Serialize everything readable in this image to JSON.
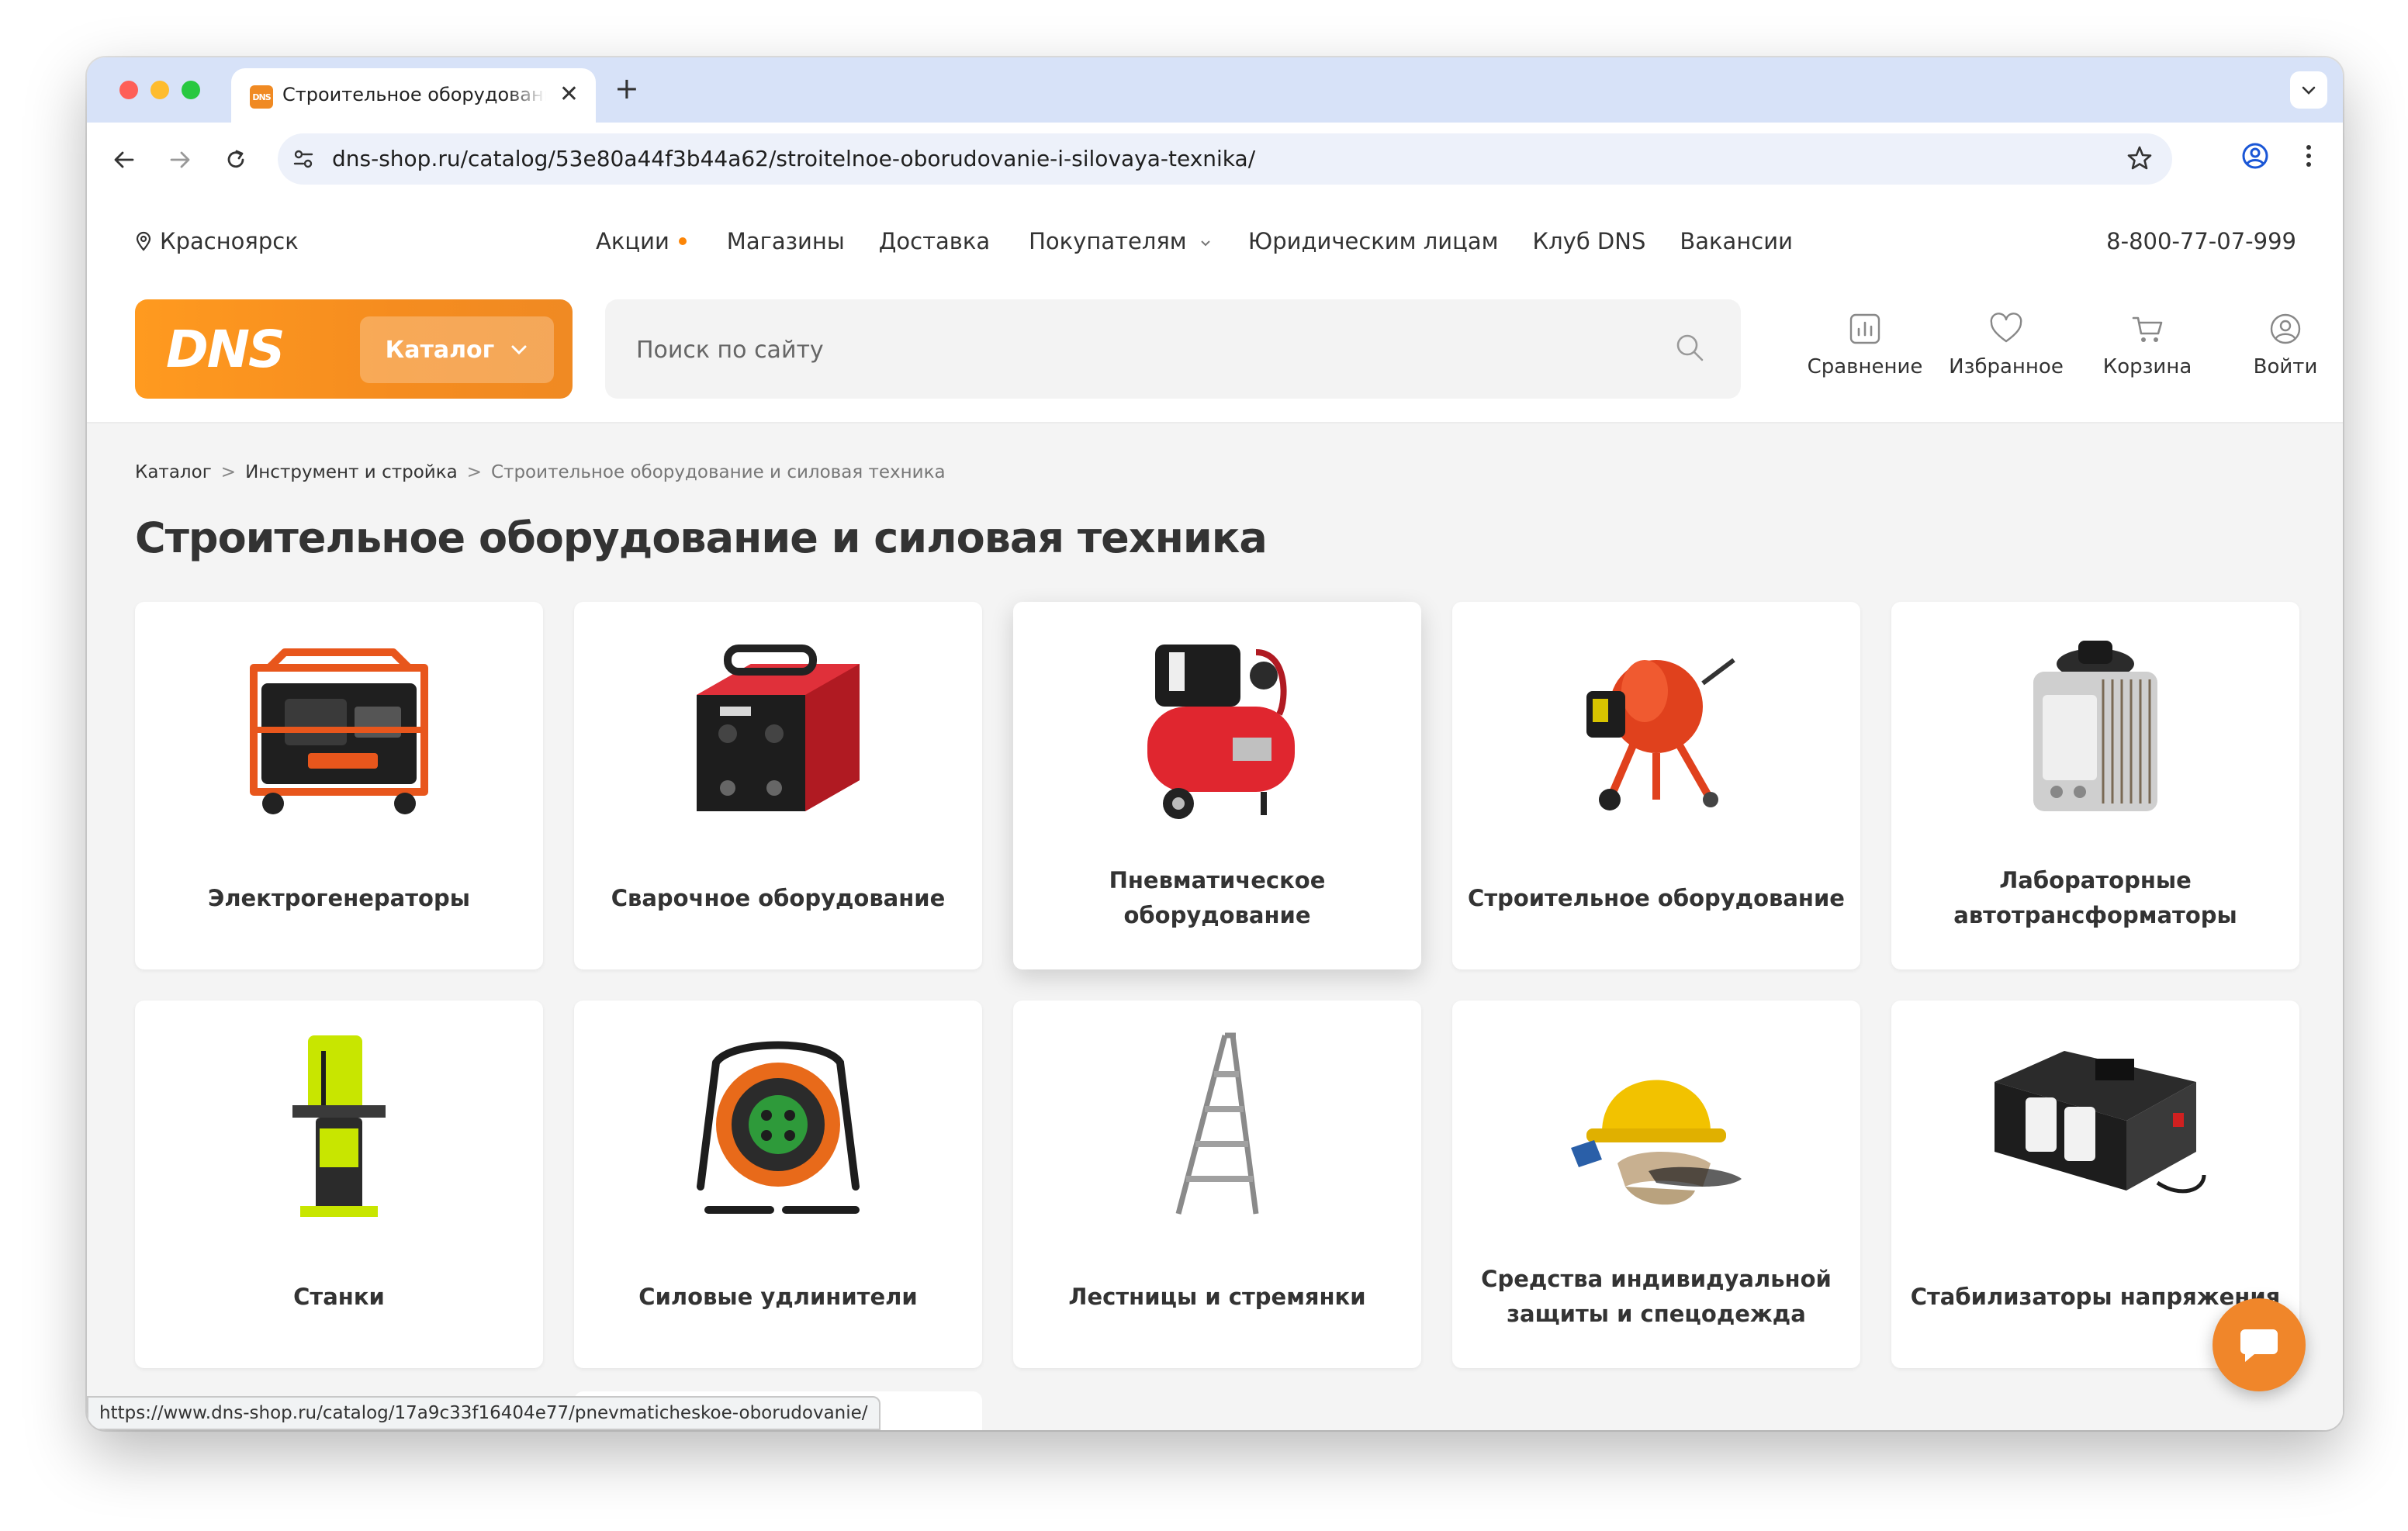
{
  "browser": {
    "tab_title": "Строительное оборудование и силовая техника",
    "tab_favicon_text": "DNS",
    "url": "dns-shop.ru/catalog/53e80a44f3b44a62/stroitelnoe-oborudovanie-i-silovaya-texnika/",
    "status_url": "https://www.dns-shop.ru/catalog/17a9c33f16404e77/pnevmaticheskoe-oborudovanie/"
  },
  "header": {
    "city": "Красноярск",
    "nav": [
      {
        "label": "Акции"
      },
      {
        "label": "Магазины"
      },
      {
        "label": "Доставка"
      },
      {
        "label": "Покупателям"
      },
      {
        "label": "Юридическим лицам"
      },
      {
        "label": "Клуб DNS"
      },
      {
        "label": "Вакансии"
      }
    ],
    "phone": "8-800-77-07-999",
    "logo": "DNS",
    "catalog_button": "Каталог",
    "search_placeholder": "Поиск по сайту",
    "actions": {
      "compare": "Сравнение",
      "favorites": "Избранное",
      "cart": "Корзина",
      "login": "Войти"
    }
  },
  "breadcrumbs": [
    "Каталог",
    "Инструмент и стройка",
    "Строительное оборудование и силовая техника"
  ],
  "page_title": "Строительное оборудование и силовая техника",
  "categories": [
    {
      "label": "Электрогенераторы",
      "icon": "generator-image"
    },
    {
      "label": "Сварочное оборудование",
      "icon": "welder-image"
    },
    {
      "label": "Пневматическое оборудование",
      "icon": "compressor-image"
    },
    {
      "label": "Строительное оборудование",
      "icon": "concrete-mixer-image"
    },
    {
      "label": "Лабораторные автотрансформаторы",
      "icon": "autotransformer-image"
    },
    {
      "label": "Станки",
      "icon": "bandsaw-image"
    },
    {
      "label": "Силовые удлинители",
      "icon": "cable-reel-image"
    },
    {
      "label": "Лестницы и стремянки",
      "icon": "ladder-image"
    },
    {
      "label": "Средства индивидуальной защиты и спецодежда",
      "icon": "hard-hat-image"
    },
    {
      "label": "Стабилизаторы напряжения",
      "icon": "stabilizer-image"
    }
  ],
  "colors": {
    "brand_orange": "#fc8507",
    "tab_strip": "#d7e2f8",
    "page_background": "#f4f4f4"
  }
}
